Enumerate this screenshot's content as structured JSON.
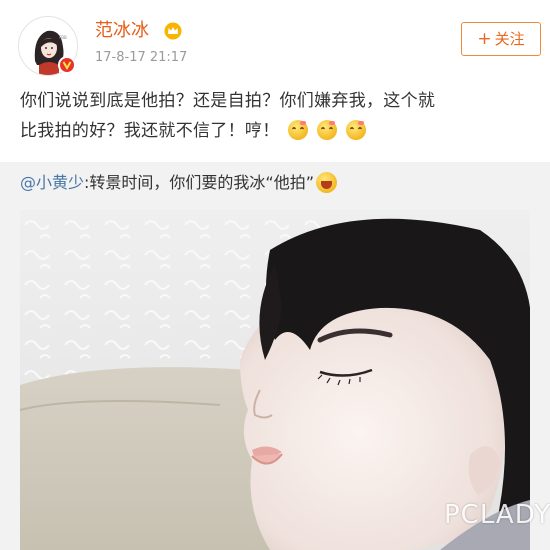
{
  "post": {
    "username": "范冰冰",
    "timestamp": "17-8-17 21:17",
    "follow_label": "关注",
    "follow_prefix": "+",
    "text_line1": "你们说说到底是他拍？还是自拍？你们嫌弃我，这个就",
    "text_line2": "比我拍的好？我还就不信了！哼！",
    "emojis": [
      "emoji-face",
      "emoji-face",
      "emoji-face"
    ]
  },
  "repost": {
    "mention": "@小黄少",
    "text": ":转景时间，你们要的我冰“他拍”",
    "emoji": "laughing-emoji"
  },
  "photo": {
    "description_icon": "sleeping-woman-photo"
  },
  "watermark": "PCLADY",
  "colors": {
    "username": "#e85d17",
    "follow_border": "#f08a3a",
    "mention": "#4a76a8",
    "repost_bg": "#f2f2f2"
  }
}
